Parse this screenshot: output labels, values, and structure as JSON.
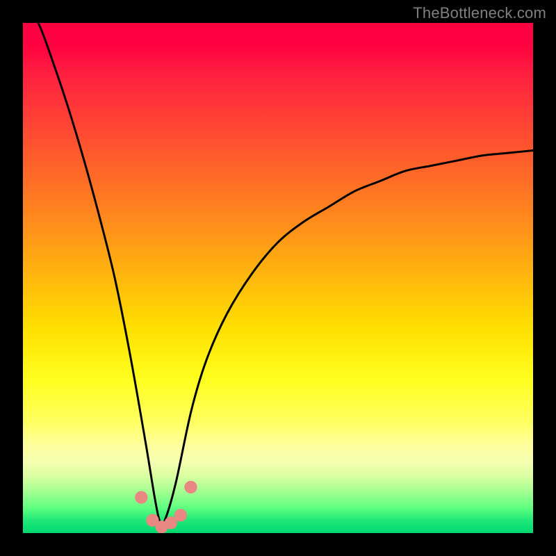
{
  "attribution": "TheBottleneck.com",
  "chart_data": {
    "type": "line",
    "title": "",
    "xlabel": "",
    "ylabel": "",
    "xlim": [
      0,
      100
    ],
    "ylim": [
      0,
      100
    ],
    "notes": "Bottleneck curve over rainbow gradient. Single black V-curve reaching minimum near x≈27 at y≈0; right branch asymptotes near y≈75 at x=100. Several salmon-colored data markers cluster at the trough around x 23–33.",
    "series": [
      {
        "name": "bottleneck-curve",
        "color": "#000000",
        "x": [
          0,
          3,
          6,
          9,
          12,
          15,
          18,
          21,
          24,
          26,
          27,
          28,
          30,
          33,
          36,
          40,
          45,
          50,
          55,
          60,
          65,
          70,
          75,
          80,
          85,
          90,
          95,
          100
        ],
        "values": [
          104,
          100,
          92,
          83,
          73,
          62,
          50,
          35,
          18,
          6,
          2,
          3,
          10,
          24,
          34,
          43,
          51,
          57,
          61,
          64,
          67,
          69,
          71,
          72,
          73,
          74,
          74.5,
          75
        ]
      }
    ],
    "markers": {
      "color": "#e98882",
      "radius_pct": 1.25,
      "points": [
        {
          "x": 23.2,
          "y": 7.0
        },
        {
          "x": 25.4,
          "y": 2.5
        },
        {
          "x": 27.2,
          "y": 1.2
        },
        {
          "x": 29.0,
          "y": 2.0
        },
        {
          "x": 30.9,
          "y": 3.5
        },
        {
          "x": 32.9,
          "y": 9.0
        }
      ]
    }
  }
}
